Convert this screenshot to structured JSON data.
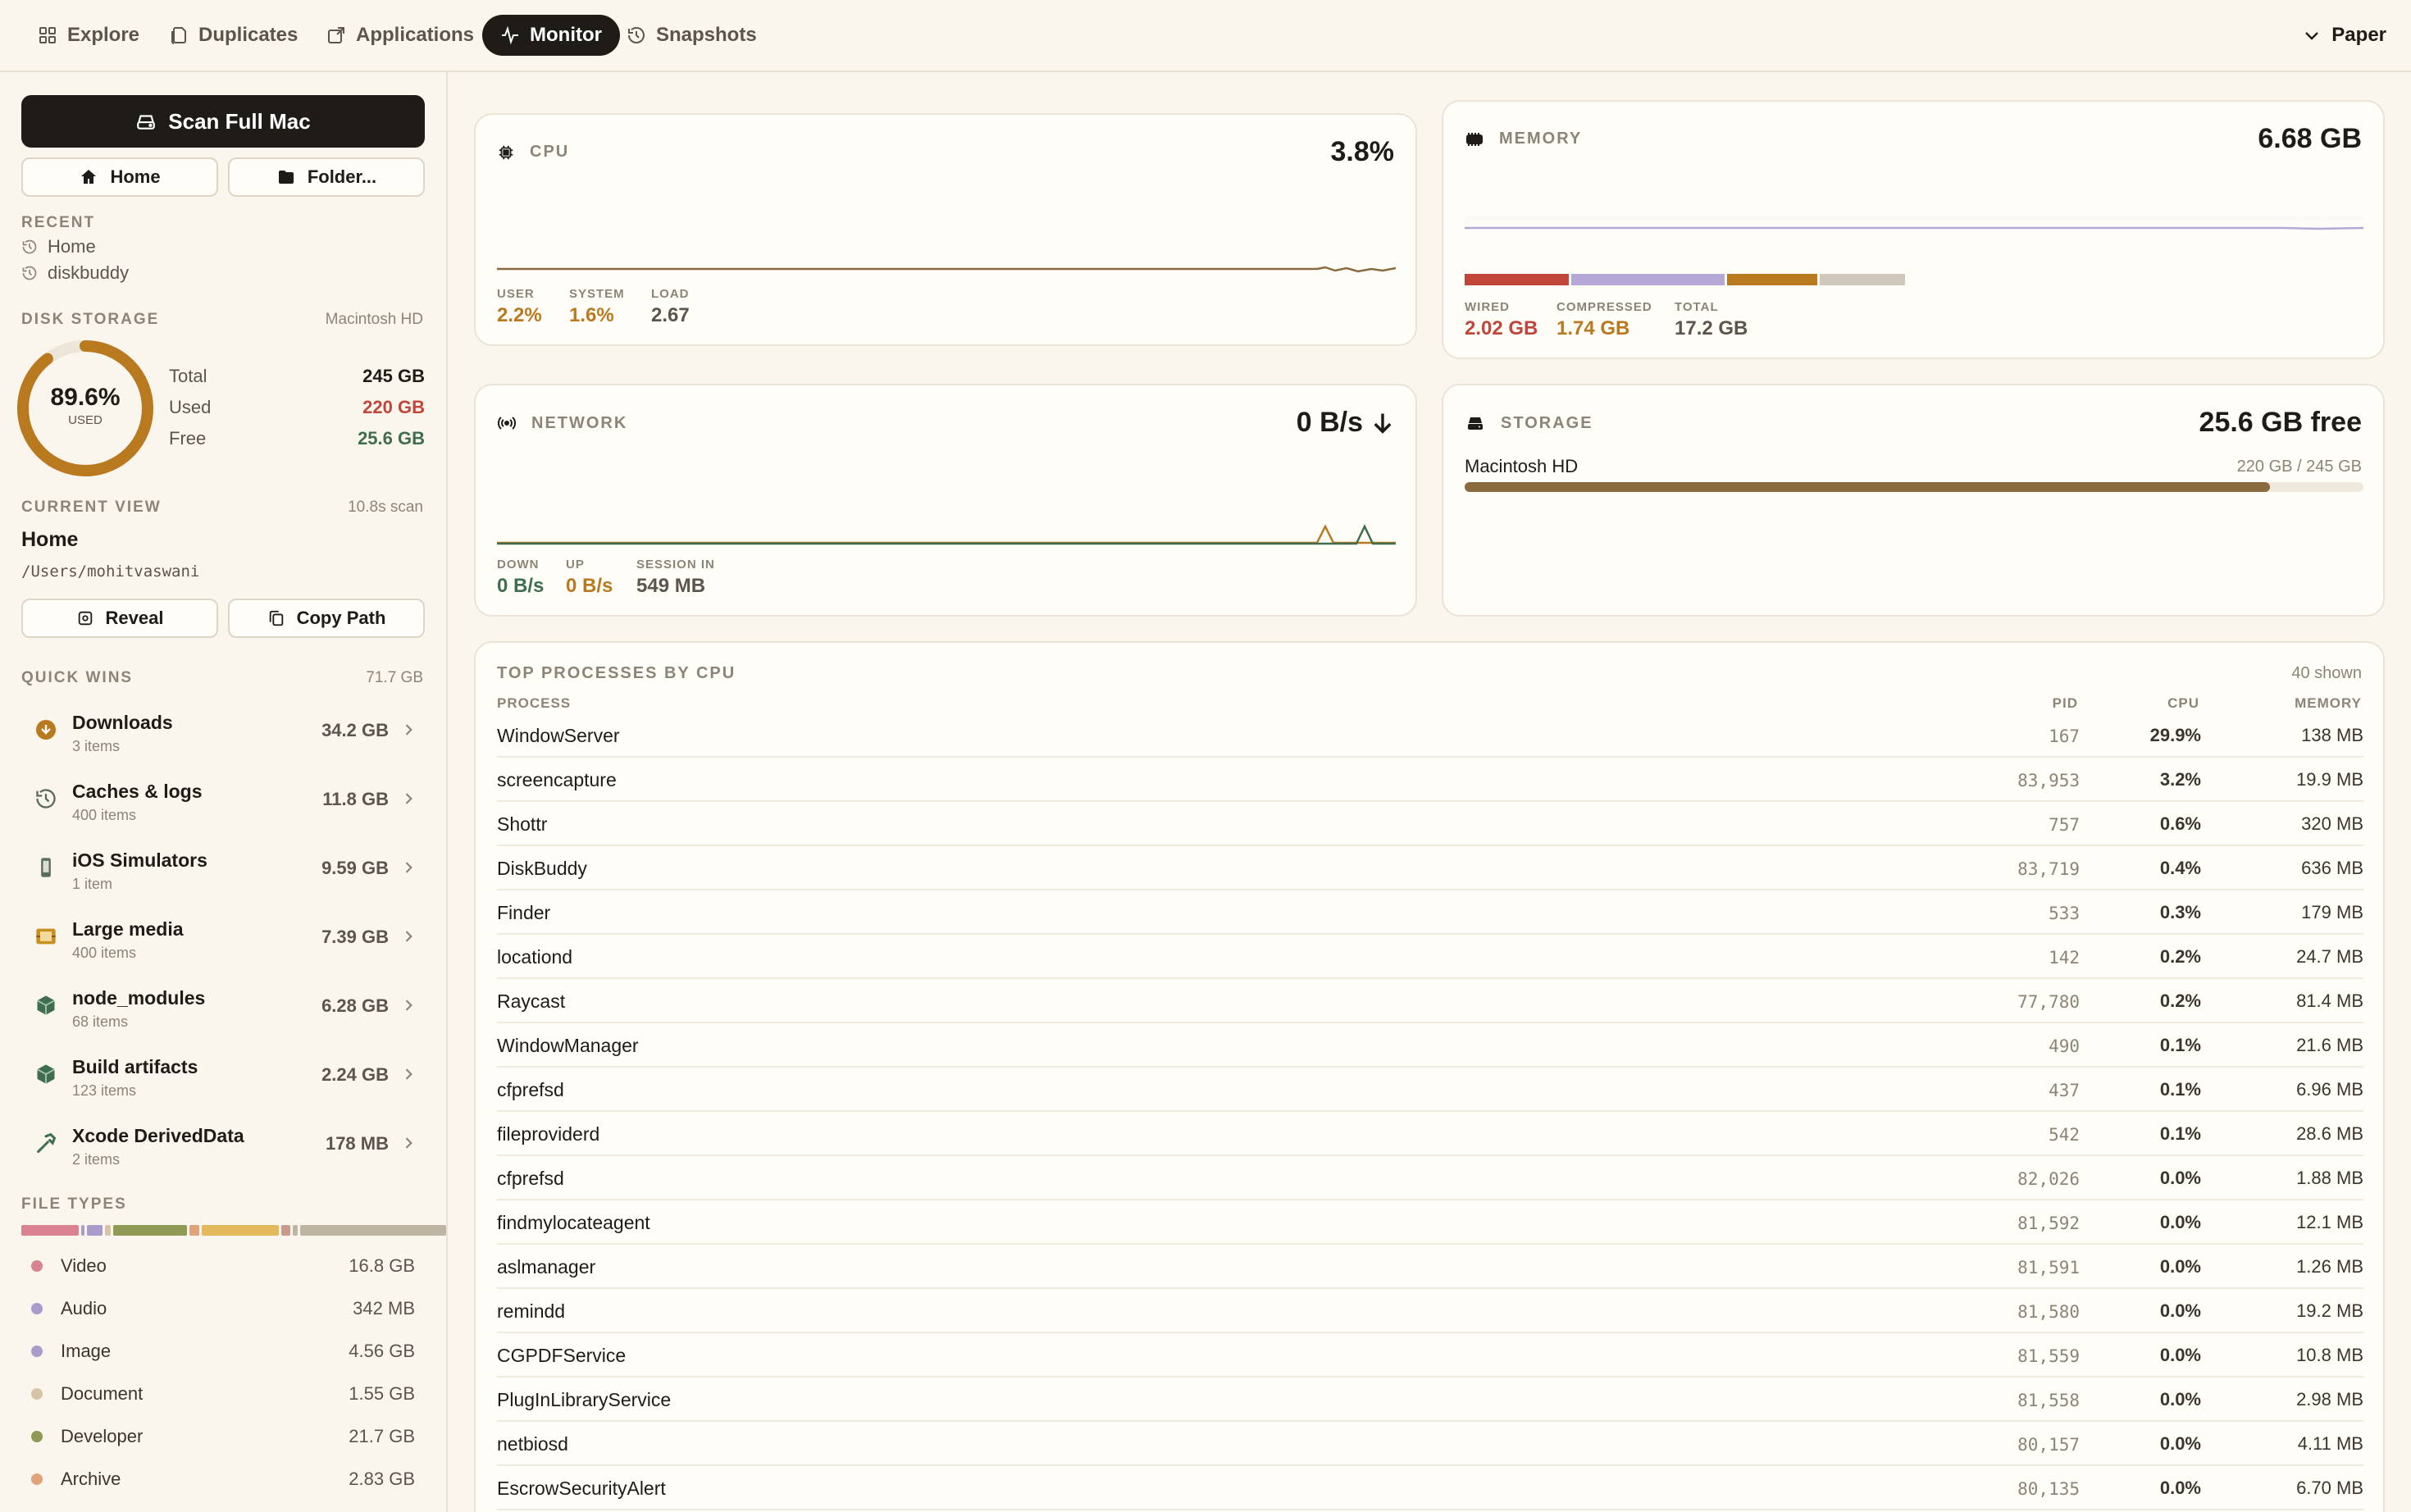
{
  "nav": {
    "tabs": [
      {
        "label": "Explore",
        "icon": "grid-icon"
      },
      {
        "label": "Duplicates",
        "icon": "files-icon"
      },
      {
        "label": "Applications",
        "icon": "app-icon"
      },
      {
        "label": "Monitor",
        "icon": "pulse-icon",
        "active": true
      },
      {
        "label": "Snapshots",
        "icon": "history-icon"
      }
    ],
    "theme_label": "Paper"
  },
  "sidebar": {
    "scan_label": "Scan Full Mac",
    "home_label": "Home",
    "folder_label": "Folder...",
    "recent_label": "RECENT",
    "recent": [
      "Home",
      "diskbuddy"
    ],
    "disk_label": "DISK STORAGE",
    "disk_name": "Macintosh HD",
    "disk_percent": "89.6%",
    "disk_percent_value": 89.6,
    "disk_used_caption": "USED",
    "total_label": "Total",
    "total_value": "245 GB",
    "used_label": "Used",
    "used_value": "220 GB",
    "free_label": "Free",
    "free_value": "25.6 GB",
    "current_label": "CURRENT VIEW",
    "scan_time": "10.8s scan",
    "current_title": "Home",
    "current_path": "/Users/mohitvaswani",
    "reveal_label": "Reveal",
    "copy_label": "Copy Path",
    "quick_label": "QUICK WINS",
    "quick_total": "71.7 GB",
    "quick_wins": [
      {
        "name": "Downloads",
        "sub": "3 items",
        "size": "34.2 GB",
        "icon": "download-icon",
        "color": "#b8791f"
      },
      {
        "name": "Caches & logs",
        "sub": "400 items",
        "size": "11.8 GB",
        "icon": "history-icon",
        "color": "#5c6b5f"
      },
      {
        "name": "iOS Simulators",
        "sub": "1 item",
        "size": "9.59 GB",
        "icon": "phone-icon",
        "color": "#5c6b5f"
      },
      {
        "name": "Large media",
        "sub": "400 items",
        "size": "7.39 GB",
        "icon": "film-icon",
        "color": "#c8901f"
      },
      {
        "name": "node_modules",
        "sub": "68 items",
        "size": "6.28 GB",
        "icon": "box-icon",
        "color": "#3e6e4e"
      },
      {
        "name": "Build artifacts",
        "sub": "123 items",
        "size": "2.24 GB",
        "icon": "box-icon",
        "color": "#3e6e4e"
      },
      {
        "name": "Xcode DerivedData",
        "sub": "2 items",
        "size": "178 MB",
        "icon": "hammer-icon",
        "color": "#3e6e4e"
      }
    ],
    "filetypes_label": "FILE TYPES",
    "filetypes": [
      {
        "name": "Video",
        "size": "16.8 GB",
        "color": "#d8838f"
      },
      {
        "name": "Audio",
        "size": "342 MB",
        "color": "#a99ccb"
      },
      {
        "name": "Image",
        "size": "4.56 GB",
        "color": "#a99ccb"
      },
      {
        "name": "Document",
        "size": "1.55 GB",
        "color": "#d6c3a8"
      },
      {
        "name": "Developer",
        "size": "21.7 GB",
        "color": "#8f9a55"
      },
      {
        "name": "Archive",
        "size": "2.83 GB",
        "color": "#e0a27a"
      }
    ],
    "filetype_bar": [
      {
        "color": "#d8838f",
        "share": 7.3
      },
      {
        "color": "#a99ccb",
        "share": 0.4
      },
      {
        "color": "#a99ccb",
        "share": 2.0
      },
      {
        "color": "#d6c3a8",
        "share": 0.7
      },
      {
        "color": "#8f9a55",
        "share": 9.4
      },
      {
        "color": "#e0a27a",
        "share": 1.2
      },
      {
        "color": "#e3b95c",
        "share": 9.8
      },
      {
        "color": "#c89a8c",
        "share": 1.2
      },
      {
        "color": "#bdb4a4",
        "share": 0.6
      },
      {
        "color": "#bdb4a4",
        "share": 18.5
      }
    ]
  },
  "cpu": {
    "title": "CPU",
    "value": "3.8%",
    "stats": [
      {
        "label": "USER",
        "value": "2.2%",
        "color": "#b8791f"
      },
      {
        "label": "SYSTEM",
        "value": "1.6%",
        "color": "#b8791f"
      },
      {
        "label": "LOAD",
        "value": "2.67",
        "color": "#5c554b"
      }
    ],
    "line_color": "#8a6a3f"
  },
  "memory": {
    "title": "MEMORY",
    "value": "6.68 GB",
    "stats": [
      {
        "label": "WIRED",
        "value": "2.02 GB",
        "color": "#c0463a"
      },
      {
        "label": "COMPRESSED",
        "value": "1.74 GB",
        "color": "#b8791f"
      },
      {
        "label": "TOTAL",
        "value": "17.2 GB",
        "color": "#5c554b"
      }
    ],
    "bar_segments": [
      {
        "color": "#c0463a",
        "share": 11.7
      },
      {
        "color": "#b5a8d6",
        "share": 17.3
      },
      {
        "color": "#b8791f",
        "share": 10.1
      },
      {
        "color": "#cfc8bb",
        "share": 9.6
      }
    ],
    "line_color": "#b5a8d6"
  },
  "network": {
    "title": "NETWORK",
    "value": "0 B/s",
    "stats": [
      {
        "label": "DOWN",
        "value": "0 B/s",
        "color": "#3e6e4e"
      },
      {
        "label": "UP",
        "value": "0 B/s",
        "color": "#b8791f"
      },
      {
        "label": "SESSION IN",
        "value": "549 MB",
        "color": "#5c554b"
      }
    ],
    "down_color": "#3e6e4e",
    "up_color": "#b8791f"
  },
  "storage": {
    "title": "STORAGE",
    "value": "25.6 GB free",
    "disk_name": "Macintosh HD",
    "disk_usage": "220 GB / 245 GB",
    "used_fraction": 0.896,
    "bar_color": "#8a6a3f"
  },
  "processes": {
    "title": "TOP PROCESSES BY CPU",
    "shown": "40 shown",
    "columns": {
      "process": "PROCESS",
      "pid": "PID",
      "cpu": "CPU",
      "memory": "MEMORY"
    },
    "rows": [
      {
        "name": "WindowServer",
        "pid": "167",
        "cpu": "29.9%",
        "mem": "138 MB"
      },
      {
        "name": "screencapture",
        "pid": "83,953",
        "cpu": "3.2%",
        "mem": "19.9 MB"
      },
      {
        "name": "Shottr",
        "pid": "757",
        "cpu": "0.6%",
        "mem": "320 MB"
      },
      {
        "name": "DiskBuddy",
        "pid": "83,719",
        "cpu": "0.4%",
        "mem": "636 MB"
      },
      {
        "name": "Finder",
        "pid": "533",
        "cpu": "0.3%",
        "mem": "179 MB"
      },
      {
        "name": "locationd",
        "pid": "142",
        "cpu": "0.2%",
        "mem": "24.7 MB"
      },
      {
        "name": "Raycast",
        "pid": "77,780",
        "cpu": "0.2%",
        "mem": "81.4 MB"
      },
      {
        "name": "WindowManager",
        "pid": "490",
        "cpu": "0.1%",
        "mem": "21.6 MB"
      },
      {
        "name": "cfprefsd",
        "pid": "437",
        "cpu": "0.1%",
        "mem": "6.96 MB"
      },
      {
        "name": "fileproviderd",
        "pid": "542",
        "cpu": "0.1%",
        "mem": "28.6 MB"
      },
      {
        "name": "cfprefsd",
        "pid": "82,026",
        "cpu": "0.0%",
        "mem": "1.88 MB"
      },
      {
        "name": "findmylocateagent",
        "pid": "81,592",
        "cpu": "0.0%",
        "mem": "12.1 MB"
      },
      {
        "name": "aslmanager",
        "pid": "81,591",
        "cpu": "0.0%",
        "mem": "1.26 MB"
      },
      {
        "name": "remindd",
        "pid": "81,580",
        "cpu": "0.0%",
        "mem": "19.2 MB"
      },
      {
        "name": "CGPDFService",
        "pid": "81,559",
        "cpu": "0.0%",
        "mem": "10.8 MB"
      },
      {
        "name": "PlugInLibraryService",
        "pid": "81,558",
        "cpu": "0.0%",
        "mem": "2.98 MB"
      },
      {
        "name": "netbiosd",
        "pid": "80,157",
        "cpu": "0.0%",
        "mem": "4.11 MB"
      },
      {
        "name": "EscrowSecurityAlert",
        "pid": "80,135",
        "cpu": "0.0%",
        "mem": "6.70 MB"
      }
    ]
  }
}
